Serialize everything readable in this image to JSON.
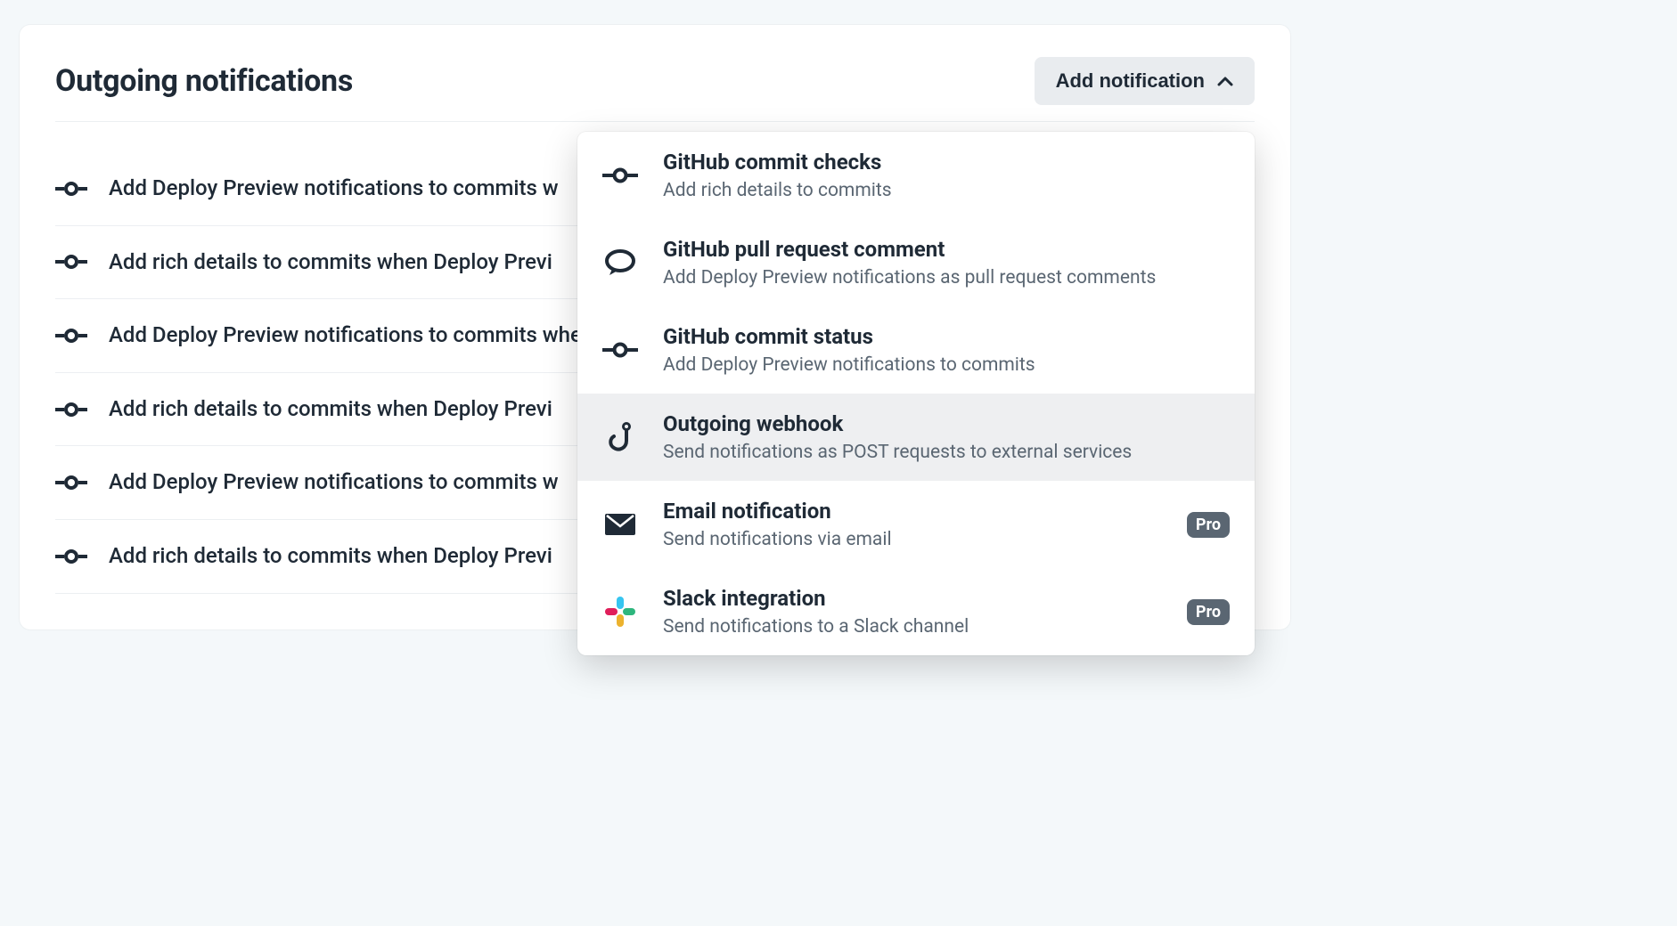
{
  "header": {
    "title": "Outgoing notifications",
    "add_button_label": "Add notification"
  },
  "list_rows": [
    {
      "text": "Add Deploy Preview notifications to commits w"
    },
    {
      "text": "Add rich details to commits when Deploy Previ"
    },
    {
      "text": "Add Deploy Preview notifications to commits when Deploy Preview succeeds"
    },
    {
      "text": "Add rich details to commits when Deploy Previ"
    },
    {
      "text": "Add Deploy Preview notifications to commits w"
    },
    {
      "text": "Add rich details to commits when Deploy Previ"
    }
  ],
  "dropdown": {
    "items": [
      {
        "icon": "commit-icon",
        "title": "GitHub commit checks",
        "desc": "Add rich details to commits"
      },
      {
        "icon": "comment-icon",
        "title": "GitHub pull request comment",
        "desc": "Add Deploy Preview notifications as pull request comments"
      },
      {
        "icon": "commit-icon",
        "title": "GitHub commit status",
        "desc": "Add Deploy Preview notifications to commits"
      },
      {
        "icon": "webhook-icon",
        "title": "Outgoing webhook",
        "desc": "Send notifications as POST requests to external services",
        "highlight": true
      },
      {
        "icon": "email-icon",
        "title": "Email notification",
        "desc": "Send notifications via email",
        "badge": "Pro"
      },
      {
        "icon": "slack-icon",
        "title": "Slack integration",
        "desc": "Send notifications to a Slack channel",
        "badge": "Pro"
      }
    ]
  },
  "icons": {
    "commit": "commit-icon",
    "comment": "comment-icon",
    "webhook": "webhook-icon",
    "email": "email-icon",
    "slack": "slack-icon",
    "chevron_up": "chevron-up-icon"
  }
}
